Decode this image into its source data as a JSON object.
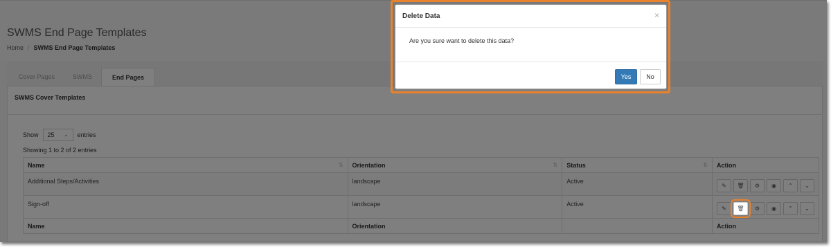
{
  "page": {
    "title": "SWMS End Page Templates",
    "breadcrumb": {
      "home": "Home",
      "separator": "/",
      "current": "SWMS End Page Templates"
    }
  },
  "tabs": [
    {
      "label": "Cover Pages",
      "active": false
    },
    {
      "label": "SWMS",
      "active": false
    },
    {
      "label": "End Pages",
      "active": true
    }
  ],
  "panel": {
    "title": "SWMS Cover Templates",
    "show_label": "Show",
    "entries_value": "25",
    "entries_label": "entries",
    "showing_text": "Showing 1 to 2 of 2 entries"
  },
  "table": {
    "columns": [
      "Name",
      "Orientation",
      "Status",
      "Action"
    ],
    "sort_icon": "⇅",
    "rows": [
      {
        "name": "Additional Steps/Activities",
        "orientation": "landscape",
        "status": "Active"
      },
      {
        "name": "Sign-off",
        "orientation": "landscape",
        "status": "Active"
      }
    ],
    "footer": [
      "Name",
      "Orientation",
      "Action"
    ],
    "action_icons": [
      "edit-icon",
      "trash-icon",
      "gear-icon",
      "eye-icon",
      "chevron-up-icon",
      "chevron-down-icon"
    ]
  },
  "modal": {
    "title": "Delete Data",
    "close": "×",
    "message": "Are you sure want to delete this data?",
    "yes_label": "Yes",
    "no_label": "No"
  },
  "colors": {
    "highlight": "#e8822c",
    "primary": "#337ab7"
  }
}
